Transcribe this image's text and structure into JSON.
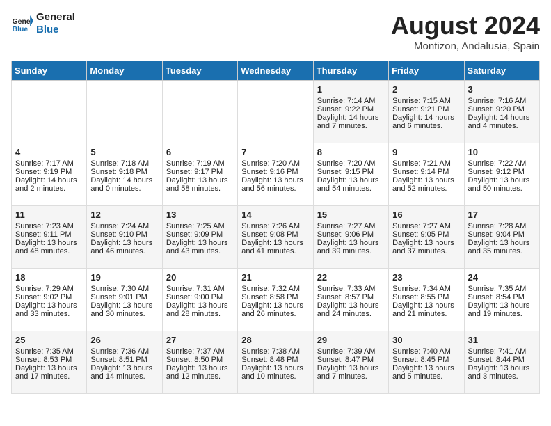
{
  "header": {
    "logo_line1": "General",
    "logo_line2": "Blue",
    "main_title": "August 2024",
    "sub_title": "Montizon, Andalusia, Spain"
  },
  "weekdays": [
    "Sunday",
    "Monday",
    "Tuesday",
    "Wednesday",
    "Thursday",
    "Friday",
    "Saturday"
  ],
  "rows": [
    [
      {
        "day": "",
        "lines": []
      },
      {
        "day": "",
        "lines": []
      },
      {
        "day": "",
        "lines": []
      },
      {
        "day": "",
        "lines": []
      },
      {
        "day": "1",
        "lines": [
          "Sunrise: 7:14 AM",
          "Sunset: 9:22 PM",
          "Daylight: 14 hours",
          "and 7 minutes."
        ]
      },
      {
        "day": "2",
        "lines": [
          "Sunrise: 7:15 AM",
          "Sunset: 9:21 PM",
          "Daylight: 14 hours",
          "and 6 minutes."
        ]
      },
      {
        "day": "3",
        "lines": [
          "Sunrise: 7:16 AM",
          "Sunset: 9:20 PM",
          "Daylight: 14 hours",
          "and 4 minutes."
        ]
      }
    ],
    [
      {
        "day": "4",
        "lines": [
          "Sunrise: 7:17 AM",
          "Sunset: 9:19 PM",
          "Daylight: 14 hours",
          "and 2 minutes."
        ]
      },
      {
        "day": "5",
        "lines": [
          "Sunrise: 7:18 AM",
          "Sunset: 9:18 PM",
          "Daylight: 14 hours",
          "and 0 minutes."
        ]
      },
      {
        "day": "6",
        "lines": [
          "Sunrise: 7:19 AM",
          "Sunset: 9:17 PM",
          "Daylight: 13 hours",
          "and 58 minutes."
        ]
      },
      {
        "day": "7",
        "lines": [
          "Sunrise: 7:20 AM",
          "Sunset: 9:16 PM",
          "Daylight: 13 hours",
          "and 56 minutes."
        ]
      },
      {
        "day": "8",
        "lines": [
          "Sunrise: 7:20 AM",
          "Sunset: 9:15 PM",
          "Daylight: 13 hours",
          "and 54 minutes."
        ]
      },
      {
        "day": "9",
        "lines": [
          "Sunrise: 7:21 AM",
          "Sunset: 9:14 PM",
          "Daylight: 13 hours",
          "and 52 minutes."
        ]
      },
      {
        "day": "10",
        "lines": [
          "Sunrise: 7:22 AM",
          "Sunset: 9:12 PM",
          "Daylight: 13 hours",
          "and 50 minutes."
        ]
      }
    ],
    [
      {
        "day": "11",
        "lines": [
          "Sunrise: 7:23 AM",
          "Sunset: 9:11 PM",
          "Daylight: 13 hours",
          "and 48 minutes."
        ]
      },
      {
        "day": "12",
        "lines": [
          "Sunrise: 7:24 AM",
          "Sunset: 9:10 PM",
          "Daylight: 13 hours",
          "and 46 minutes."
        ]
      },
      {
        "day": "13",
        "lines": [
          "Sunrise: 7:25 AM",
          "Sunset: 9:09 PM",
          "Daylight: 13 hours",
          "and 43 minutes."
        ]
      },
      {
        "day": "14",
        "lines": [
          "Sunrise: 7:26 AM",
          "Sunset: 9:08 PM",
          "Daylight: 13 hours",
          "and 41 minutes."
        ]
      },
      {
        "day": "15",
        "lines": [
          "Sunrise: 7:27 AM",
          "Sunset: 9:06 PM",
          "Daylight: 13 hours",
          "and 39 minutes."
        ]
      },
      {
        "day": "16",
        "lines": [
          "Sunrise: 7:27 AM",
          "Sunset: 9:05 PM",
          "Daylight: 13 hours",
          "and 37 minutes."
        ]
      },
      {
        "day": "17",
        "lines": [
          "Sunrise: 7:28 AM",
          "Sunset: 9:04 PM",
          "Daylight: 13 hours",
          "and 35 minutes."
        ]
      }
    ],
    [
      {
        "day": "18",
        "lines": [
          "Sunrise: 7:29 AM",
          "Sunset: 9:02 PM",
          "Daylight: 13 hours",
          "and 33 minutes."
        ]
      },
      {
        "day": "19",
        "lines": [
          "Sunrise: 7:30 AM",
          "Sunset: 9:01 PM",
          "Daylight: 13 hours",
          "and 30 minutes."
        ]
      },
      {
        "day": "20",
        "lines": [
          "Sunrise: 7:31 AM",
          "Sunset: 9:00 PM",
          "Daylight: 13 hours",
          "and 28 minutes."
        ]
      },
      {
        "day": "21",
        "lines": [
          "Sunrise: 7:32 AM",
          "Sunset: 8:58 PM",
          "Daylight: 13 hours",
          "and 26 minutes."
        ]
      },
      {
        "day": "22",
        "lines": [
          "Sunrise: 7:33 AM",
          "Sunset: 8:57 PM",
          "Daylight: 13 hours",
          "and 24 minutes."
        ]
      },
      {
        "day": "23",
        "lines": [
          "Sunrise: 7:34 AM",
          "Sunset: 8:55 PM",
          "Daylight: 13 hours",
          "and 21 minutes."
        ]
      },
      {
        "day": "24",
        "lines": [
          "Sunrise: 7:35 AM",
          "Sunset: 8:54 PM",
          "Daylight: 13 hours",
          "and 19 minutes."
        ]
      }
    ],
    [
      {
        "day": "25",
        "lines": [
          "Sunrise: 7:35 AM",
          "Sunset: 8:53 PM",
          "Daylight: 13 hours",
          "and 17 minutes."
        ]
      },
      {
        "day": "26",
        "lines": [
          "Sunrise: 7:36 AM",
          "Sunset: 8:51 PM",
          "Daylight: 13 hours",
          "and 14 minutes."
        ]
      },
      {
        "day": "27",
        "lines": [
          "Sunrise: 7:37 AM",
          "Sunset: 8:50 PM",
          "Daylight: 13 hours",
          "and 12 minutes."
        ]
      },
      {
        "day": "28",
        "lines": [
          "Sunrise: 7:38 AM",
          "Sunset: 8:48 PM",
          "Daylight: 13 hours",
          "and 10 minutes."
        ]
      },
      {
        "day": "29",
        "lines": [
          "Sunrise: 7:39 AM",
          "Sunset: 8:47 PM",
          "Daylight: 13 hours",
          "and 7 minutes."
        ]
      },
      {
        "day": "30",
        "lines": [
          "Sunrise: 7:40 AM",
          "Sunset: 8:45 PM",
          "Daylight: 13 hours",
          "and 5 minutes."
        ]
      },
      {
        "day": "31",
        "lines": [
          "Sunrise: 7:41 AM",
          "Sunset: 8:44 PM",
          "Daylight: 13 hours",
          "and 3 minutes."
        ]
      }
    ]
  ]
}
